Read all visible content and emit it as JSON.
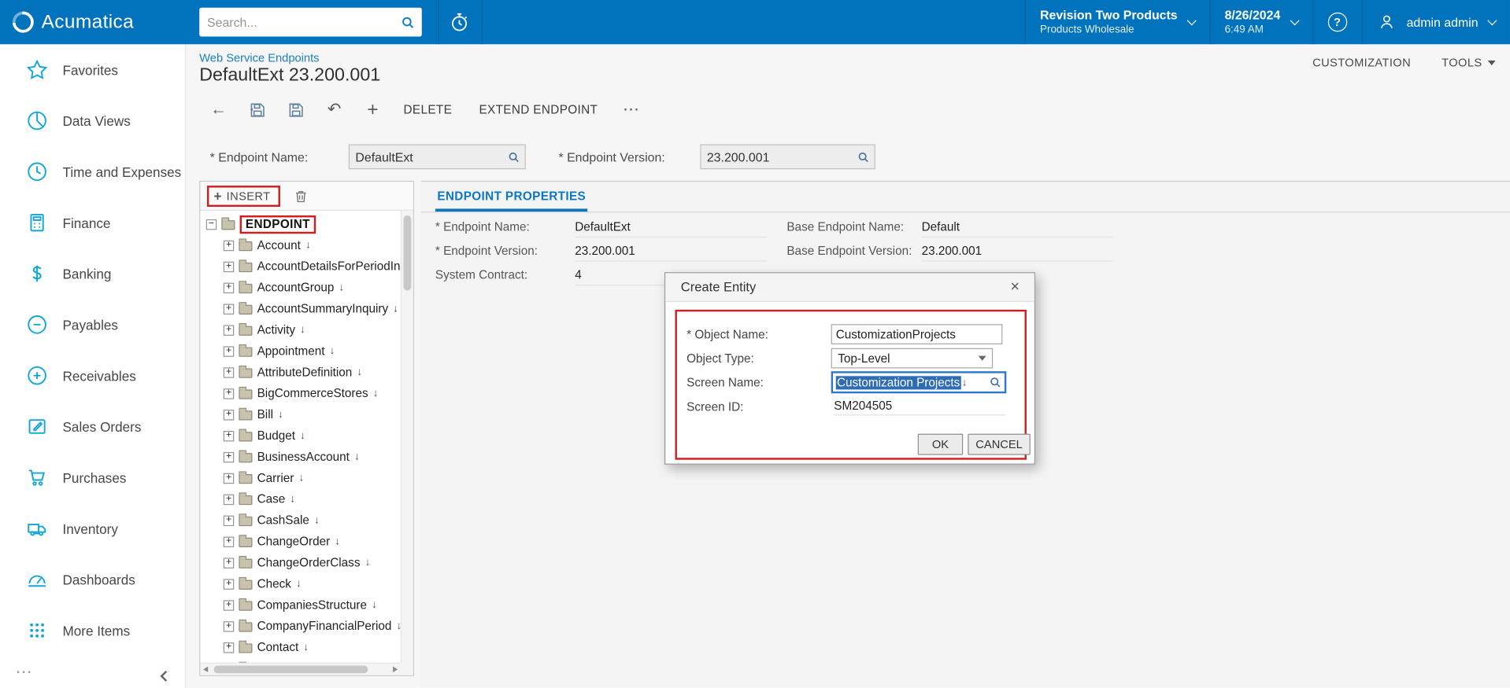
{
  "colors": {
    "topbar_blue": "#0173BC",
    "link_blue": "#1B7FC5",
    "tab_blue": "#0B77C2",
    "sidebar_icon_teal": "#12A6D7",
    "annotation_red": "#CF2020",
    "selection_blue": "#2E6DB5"
  },
  "glyphs": {
    "back": "←",
    "undo": "↶",
    "insert_plus": "+",
    "more": "⋯"
  },
  "topbar": {
    "brand": "Acumatica",
    "search": {
      "placeholder": "Search..."
    },
    "company": {
      "name": "Revision Two Products",
      "branch": "Products Wholesale"
    },
    "datetime": {
      "date": "8/26/2024",
      "time": "6:49 AM"
    },
    "user": {
      "name": "admin admin"
    }
  },
  "sidebar": {
    "items": [
      {
        "label": "Favorites",
        "icon": "star-icon"
      },
      {
        "label": "Data Views",
        "icon": "data-views-icon"
      },
      {
        "label": "Time and Expenses",
        "icon": "clock-icon"
      },
      {
        "label": "Finance",
        "icon": "calculator-icon"
      },
      {
        "label": "Banking",
        "icon": "dollar-icon"
      },
      {
        "label": "Payables",
        "icon": "minus-circle-icon"
      },
      {
        "label": "Receivables",
        "icon": "plus-circle-icon"
      },
      {
        "label": "Sales Orders",
        "icon": "pencil-pad-icon"
      },
      {
        "label": "Purchases",
        "icon": "cart-icon"
      },
      {
        "label": "Inventory",
        "icon": "truck-icon"
      },
      {
        "label": "Dashboards",
        "icon": "gauge-icon"
      },
      {
        "label": "More Items",
        "icon": "grid-dots-icon"
      }
    ]
  },
  "header": {
    "breadcrumb": "Web Service Endpoints",
    "title": "DefaultExt 23.200.001",
    "customization_label": "CUSTOMIZATION",
    "tools_label": "TOOLS"
  },
  "toolbar": {
    "delete_label": "DELETE",
    "extend_label": "EXTEND ENDPOINT"
  },
  "filter_form": {
    "endpoint_name_label": "* Endpoint Name:",
    "endpoint_name_value": "DefaultExt",
    "endpoint_version_label": "* Endpoint Version:",
    "endpoint_version_value": "23.200.001"
  },
  "tree_panel": {
    "insert_label": "INSERT",
    "root_label": "ENDPOINT",
    "items": [
      {
        "label": "Account",
        "arrow": "↓"
      },
      {
        "label": "AccountDetailsForPeriodInqui",
        "arrow": ""
      },
      {
        "label": "AccountGroup",
        "arrow": "↓"
      },
      {
        "label": "AccountSummaryInquiry",
        "arrow": "↓"
      },
      {
        "label": "Activity",
        "arrow": "↓"
      },
      {
        "label": "Appointment",
        "arrow": "↓"
      },
      {
        "label": "AttributeDefinition",
        "arrow": "↓"
      },
      {
        "label": "BigCommerceStores",
        "arrow": "↓"
      },
      {
        "label": "Bill",
        "arrow": "↓"
      },
      {
        "label": "Budget",
        "arrow": "↓"
      },
      {
        "label": "BusinessAccount",
        "arrow": "↓"
      },
      {
        "label": "Carrier",
        "arrow": "↓"
      },
      {
        "label": "Case",
        "arrow": "↓"
      },
      {
        "label": "CashSale",
        "arrow": "↓"
      },
      {
        "label": "ChangeOrder",
        "arrow": "↓"
      },
      {
        "label": "ChangeOrderClass",
        "arrow": "↓"
      },
      {
        "label": "Check",
        "arrow": "↓"
      },
      {
        "label": "CompaniesStructure",
        "arrow": "↓"
      },
      {
        "label": "CompanyFinancialPeriod",
        "arrow": "↓"
      },
      {
        "label": "Contact",
        "arrow": "↓"
      },
      {
        "label": "ContractUsage",
        "arrow": "↓"
      }
    ]
  },
  "properties": {
    "tab_label": "ENDPOINT PROPERTIES",
    "fields": {
      "endpoint_name": {
        "label": "* Endpoint Name:",
        "value": "DefaultExt"
      },
      "endpoint_version": {
        "label": "* Endpoint Version:",
        "value": "23.200.001"
      },
      "system_contract": {
        "label": "System Contract:",
        "value": "4"
      },
      "base_endpoint_name": {
        "label": "Base Endpoint Name:",
        "value": "Default"
      },
      "base_endpoint_version": {
        "label": "Base Endpoint Version:",
        "value": "23.200.001"
      }
    }
  },
  "modal": {
    "title": "Create Entity",
    "fields": {
      "object_name": {
        "label": "* Object Name:",
        "value": "CustomizationProjects"
      },
      "object_type": {
        "label": "Object Type:",
        "value": "Top-Level"
      },
      "screen_name": {
        "label": "Screen Name:",
        "value": "Customization Projects",
        "arrow": "↓"
      },
      "screen_id": {
        "label": "Screen ID:",
        "value": "SM204505"
      }
    },
    "ok_label": "OK",
    "cancel_label": "CANCEL"
  }
}
